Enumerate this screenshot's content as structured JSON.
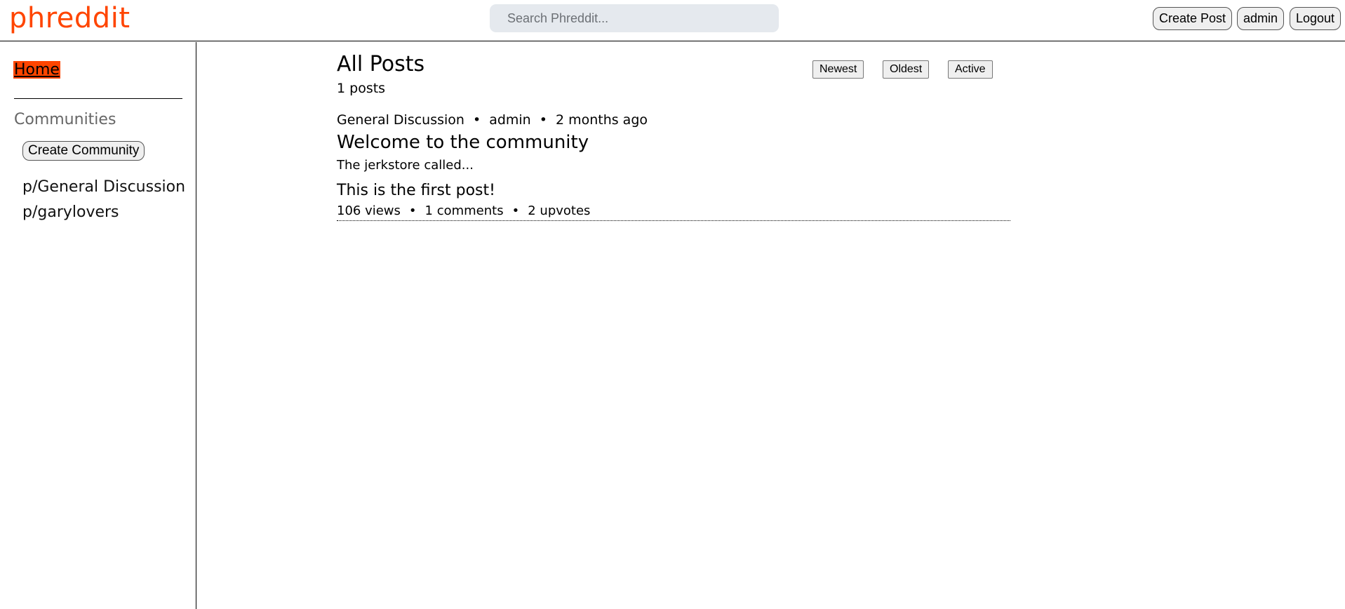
{
  "header": {
    "logo": "phreddit",
    "search_placeholder": "Search Phreddit...",
    "create_post_label": "Create Post",
    "user_label": "admin",
    "logout_label": "Logout"
  },
  "sidebar": {
    "home_label": "Home",
    "communities_label": "Communities",
    "create_community_label": "Create Community",
    "communities": [
      "p/General Discussion",
      "p/garylovers"
    ]
  },
  "main": {
    "title": "All Posts",
    "post_count": "1 posts",
    "sort_buttons": [
      "Newest",
      "Oldest",
      "Active"
    ],
    "posts": [
      {
        "community": "General Discussion",
        "author": "admin",
        "time": "2 months ago",
        "separator": "•",
        "title": "Welcome to the community",
        "link_flair": "The jerkstore called...",
        "content": "This is the first post!",
        "views": "106 views",
        "comments": "1 comments",
        "upvotes": "2 upvotes"
      }
    ]
  },
  "colors": {
    "brand": "#ff4500",
    "search_bg": "#e5e9ee",
    "button_bg": "#efefef"
  }
}
